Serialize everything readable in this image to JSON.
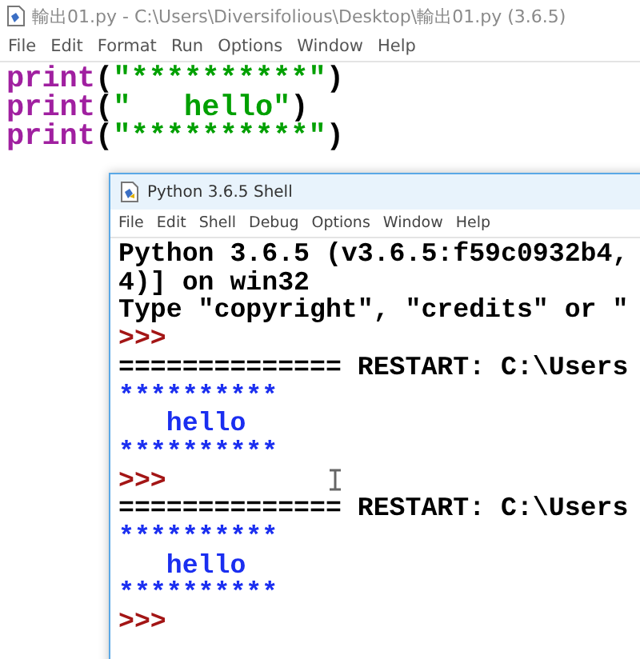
{
  "editor": {
    "title": "輸出01.py - C:\\Users\\Diversifolious\\Desktop\\輸出01.py (3.6.5)",
    "menu": [
      "File",
      "Edit",
      "Format",
      "Run",
      "Options",
      "Window",
      "Help"
    ],
    "lines": [
      [
        {
          "kind": "builtin",
          "text": "print"
        },
        {
          "kind": "plain",
          "text": "("
        },
        {
          "kind": "string",
          "text": "\"**********\""
        },
        {
          "kind": "plain",
          "text": ")"
        }
      ],
      [
        {
          "kind": "builtin",
          "text": "print"
        },
        {
          "kind": "plain",
          "text": "("
        },
        {
          "kind": "string",
          "text": "\"   hello\""
        },
        {
          "kind": "plain",
          "text": ")"
        }
      ],
      [
        {
          "kind": "builtin",
          "text": "print"
        },
        {
          "kind": "plain",
          "text": "("
        },
        {
          "kind": "string",
          "text": "\"**********\""
        },
        {
          "kind": "plain",
          "text": ")"
        }
      ]
    ]
  },
  "shell": {
    "title": "Python 3.6.5 Shell",
    "menu": [
      "File",
      "Edit",
      "Shell",
      "Debug",
      "Options",
      "Window",
      "Help"
    ],
    "lines": [
      {
        "kind": "banner",
        "text": "Python 3.6.5 (v3.6.5:f59c0932b4,"
      },
      {
        "kind": "banner",
        "text": "4)] on win32"
      },
      {
        "kind": "banner",
        "text": "Type \"copyright\", \"credits\" or \""
      },
      {
        "kind": "prompt",
        "text": ">>>"
      },
      {
        "kind": "banner",
        "text": "============== RESTART: C:\\Users"
      },
      {
        "kind": "stdout",
        "text": "**********"
      },
      {
        "kind": "stdout",
        "text": "   hello"
      },
      {
        "kind": "stdout",
        "text": "**********"
      },
      {
        "kind": "prompt",
        "text": ">>>"
      },
      {
        "kind": "banner",
        "text": "============== RESTART: C:\\Users"
      },
      {
        "kind": "stdout",
        "text": "**********"
      },
      {
        "kind": "stdout",
        "text": "   hello"
      },
      {
        "kind": "stdout",
        "text": "**********"
      },
      {
        "kind": "prompt",
        "text": ">>>"
      }
    ]
  }
}
